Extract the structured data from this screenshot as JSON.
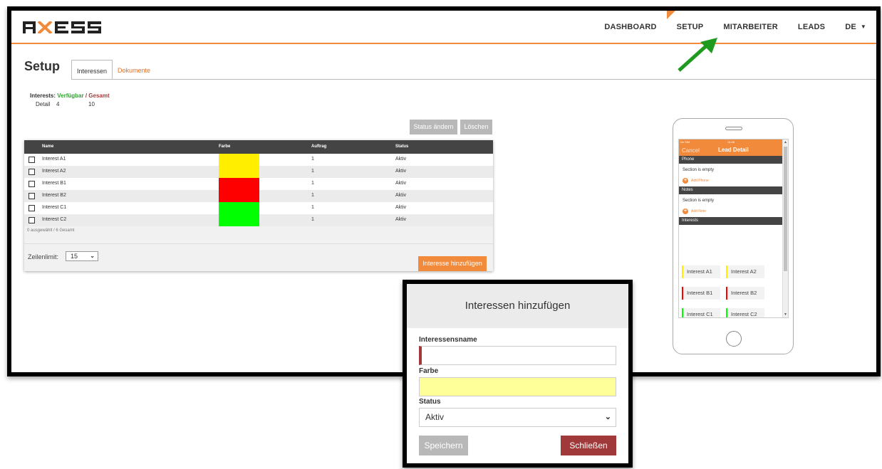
{
  "colors": {
    "accent": "#f28a3c",
    "dark_header": "#444444",
    "danger": "#a03a3a",
    "green": "#2fa12f",
    "yellow": "#ffee00",
    "red": "#ff0000",
    "lime": "#00ff00"
  },
  "logo": {
    "text": "AXESS"
  },
  "nav": {
    "items": [
      {
        "label": "DASHBOARD"
      },
      {
        "label": "SETUP"
      },
      {
        "label": "MITARBEITER"
      },
      {
        "label": "LEADS"
      },
      {
        "label": "DE"
      }
    ]
  },
  "page": {
    "title": "Setup"
  },
  "tabs": [
    {
      "label": "Interessen"
    },
    {
      "label": "Dokumente"
    }
  ],
  "summary": {
    "label": "Interests:",
    "available_label": "Verfügbar",
    "separator": "/",
    "total_label": "Gesamt",
    "row_label": "Detail",
    "available": "4",
    "total": "10"
  },
  "toolbar": {
    "status_label": "Status ändern",
    "delete_label": "Löschen"
  },
  "table": {
    "columns": {
      "name": "Name",
      "color": "Farbe",
      "order": "Auftrag",
      "status": "Status"
    },
    "rows": [
      {
        "name": "Interest A1",
        "order": "1",
        "status": "Aktiv",
        "color": "#ffee00"
      },
      {
        "name": "Interest A2",
        "order": "1",
        "status": "Aktiv",
        "color": "#ffee00"
      },
      {
        "name": "Interest B1",
        "order": "1",
        "status": "Aktiv",
        "color": "#ff0000"
      },
      {
        "name": "Interest B2",
        "order": "1",
        "status": "Aktiv",
        "color": "#ff0000"
      },
      {
        "name": "Interest C1",
        "order": "1",
        "status": "Aktiv",
        "color": "#00ff00"
      },
      {
        "name": "Interest C2",
        "order": "1",
        "status": "Aktiv",
        "color": "#00ff00"
      }
    ],
    "footer": "0 ausgewählt / 6 Gesamt",
    "row_limit_label": "Zeilenlimit:",
    "row_limit_value": "15",
    "add_label": "Interesse hinzufügen"
  },
  "phone": {
    "carrier": "No SIM",
    "time": "14:48",
    "cancel": "Cancel",
    "title": "Lead Detail",
    "sections": {
      "phone": "Phone",
      "notes": "Notes",
      "interests": "Interests"
    },
    "empty_text": "Section is empty",
    "add_phone": "Add Phone",
    "add_note": "Add Note",
    "chips": [
      {
        "label": "Interest A1",
        "color": "#ffee00"
      },
      {
        "label": "Interest A2",
        "color": "#ffee00"
      },
      {
        "label": "Interest B1",
        "color": "#ff0000"
      },
      {
        "label": "Interest B2",
        "color": "#ff0000"
      },
      {
        "label": "Interest C1",
        "color": "#00ff00"
      },
      {
        "label": "Interest C2",
        "color": "#00ff00"
      }
    ]
  },
  "modal": {
    "title": "Interessen hinzufügen",
    "name_label": "Interessensname",
    "name_value": "",
    "color_label": "Farbe",
    "color_value": "#ffff99",
    "status_label": "Status",
    "status_value": "Aktiv",
    "save_label": "Speichern",
    "close_label": "Schließen"
  }
}
